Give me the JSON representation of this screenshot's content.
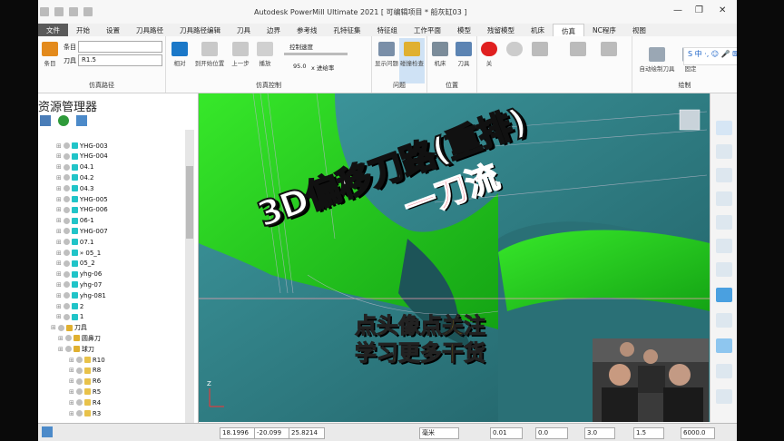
{
  "title_bar": {
    "text": "Autodesk PowerMill Ultimate 2021 [ 可编辑项目 * 船灰缸03 ]"
  },
  "menu": [
    "文件",
    "开始",
    "设置",
    "刀具路径",
    "刀具路径编辑",
    "刀具",
    "边界",
    "参考线",
    "孔特征集",
    "特征组",
    "工作平面",
    "模型",
    "残留模型",
    "机床",
    "仿真",
    "NC程序",
    "视图"
  ],
  "menu_active": "仿真",
  "ribbon": {
    "path_group": {
      "caption": "仿真路径",
      "entity_label": "条目",
      "entity_button": "条目",
      "tool_label": "刀具",
      "tool_value": "R1.5"
    },
    "control_group": {
      "caption": "仿真控制",
      "buttons": [
        "相对",
        "到开始位置",
        "上一步",
        "播放",
        "下一步",
        "到仿真结尾"
      ],
      "speed_label": "控制速度",
      "feed_value": "95.0",
      "feed_unit": "x 进给率"
    },
    "issues_group": {
      "caption": "问题",
      "buttons": [
        "显示问题",
        "碰撞检查"
      ]
    },
    "position_group": {
      "caption": "位置",
      "buttons": [
        "机床",
        "刀具"
      ]
    },
    "sim_group": {
      "buttons": [
        "关"
      ]
    },
    "draw_group": {
      "caption": "绘制",
      "buttons": [
        "自动绘制刀具",
        "固定"
      ]
    },
    "ime_text": "S 中 ·, ☺ 🎤 ⌨"
  },
  "explorer": {
    "title": "资源管理器",
    "rows": [
      {
        "label": "YHG-003",
        "kind": "toolpath"
      },
      {
        "label": "YHG-004",
        "kind": "toolpath"
      },
      {
        "label": "04.1",
        "kind": "toolpath"
      },
      {
        "label": "04.2",
        "kind": "toolpath"
      },
      {
        "label": "04.3",
        "kind": "toolpath"
      },
      {
        "label": "YHG-005",
        "kind": "toolpath"
      },
      {
        "label": "YHG-006",
        "kind": "toolpath"
      },
      {
        "label": "06-1",
        "kind": "toolpath"
      },
      {
        "label": "YHG-007",
        "kind": "toolpath"
      },
      {
        "label": "07.1",
        "kind": "toolpath"
      },
      {
        "label": "» 05_1",
        "kind": "toolpath"
      },
      {
        "label": "05_2",
        "kind": "toolpath"
      },
      {
        "label": "yhg-06",
        "kind": "toolpath"
      },
      {
        "label": "yhg-07",
        "kind": "toolpath"
      },
      {
        "label": "yhg-081",
        "kind": "toolpath"
      },
      {
        "label": "2",
        "kind": "toolpath"
      },
      {
        "label": "1",
        "kind": "toolpath"
      },
      {
        "label": "刀具",
        "kind": "folder"
      },
      {
        "label": "圆鼻刀",
        "kind": "folder"
      },
      {
        "label": "球刀",
        "kind": "folder"
      },
      {
        "label": "R10",
        "kind": "tool"
      },
      {
        "label": "R8",
        "kind": "tool"
      },
      {
        "label": "R6",
        "kind": "tool"
      },
      {
        "label": "R5",
        "kind": "tool"
      },
      {
        "label": "R4",
        "kind": "tool"
      },
      {
        "label": "R3",
        "kind": "tool"
      }
    ]
  },
  "overlay": {
    "line1": "3D偏移刀路(重排)",
    "line2": "一刀流",
    "cta1": "点头像点关注",
    "cta2": "学习更多干货"
  },
  "viewport": {
    "axis_label": "Z"
  },
  "status": {
    "x": "18.1996",
    "y": "-20.099",
    "z": "25.8214",
    "unit": "毫米",
    "tol1": "0.01",
    "tol2": "0.0",
    "tol3": "3.0",
    "tol4": "1.5",
    "feed": "6000.0"
  },
  "colors": {
    "accent": "#0e7fd6",
    "toolpath_green": "#21d11a",
    "stock_teal": "#2f7d84",
    "overlay_line2": "#e0102f",
    "overlay_cta": "#ffd400"
  }
}
